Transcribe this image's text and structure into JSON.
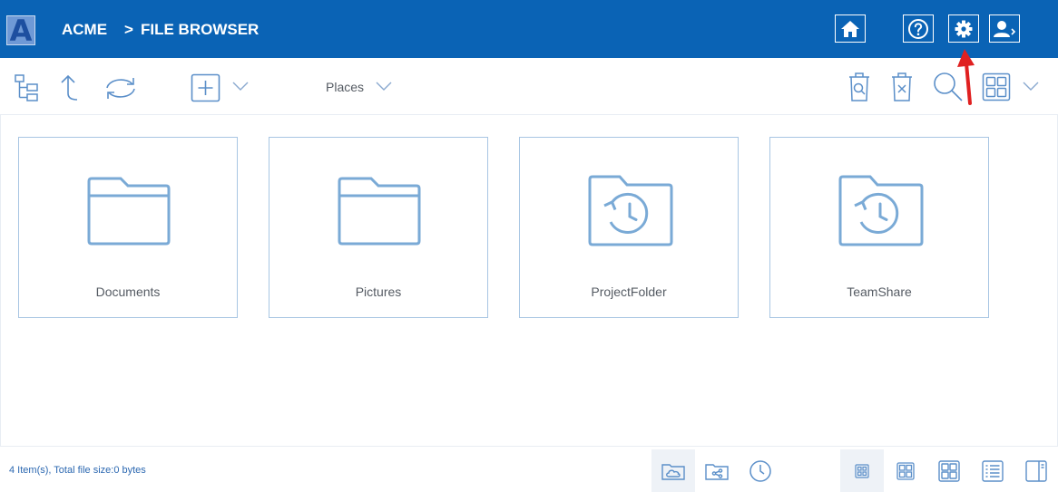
{
  "header": {
    "logo_letter": "A",
    "app_name": "ACME",
    "separator": ">",
    "page_title": "FILE BROWSER",
    "bg_color": "#0a63b5",
    "icons": [
      "home-icon",
      "help-icon",
      "gear-icon",
      "user-logout-icon"
    ]
  },
  "toolbar": {
    "places_label": "Places",
    "icons": [
      "folder-tree-icon",
      "up-arrow-icon",
      "refresh-icon",
      "add-icon",
      "chevron-down-icon",
      "recycle-bin-search-icon",
      "delete-icon",
      "search-icon",
      "grid-view-icon",
      "chevron-down-icon"
    ]
  },
  "folders": [
    {
      "name": "Documents",
      "icon": "folder-icon"
    },
    {
      "name": "Pictures",
      "icon": "folder-icon"
    },
    {
      "name": "ProjectFolder",
      "icon": "folder-history-icon"
    },
    {
      "name": "TeamShare",
      "icon": "folder-history-icon"
    }
  ],
  "footer": {
    "status": "4 Item(s), Total file size:0 bytes",
    "location_icons": [
      "cloud-folder-icon",
      "shared-folder-icon",
      "recent-icon"
    ],
    "view_icons": [
      "small-icons-view-icon",
      "medium-icons-view-icon",
      "large-icons-view-icon",
      "list-view-icon",
      "preview-pane-icon"
    ]
  },
  "accent_color": "#5b8fc9",
  "annotation_color": "#e02020"
}
